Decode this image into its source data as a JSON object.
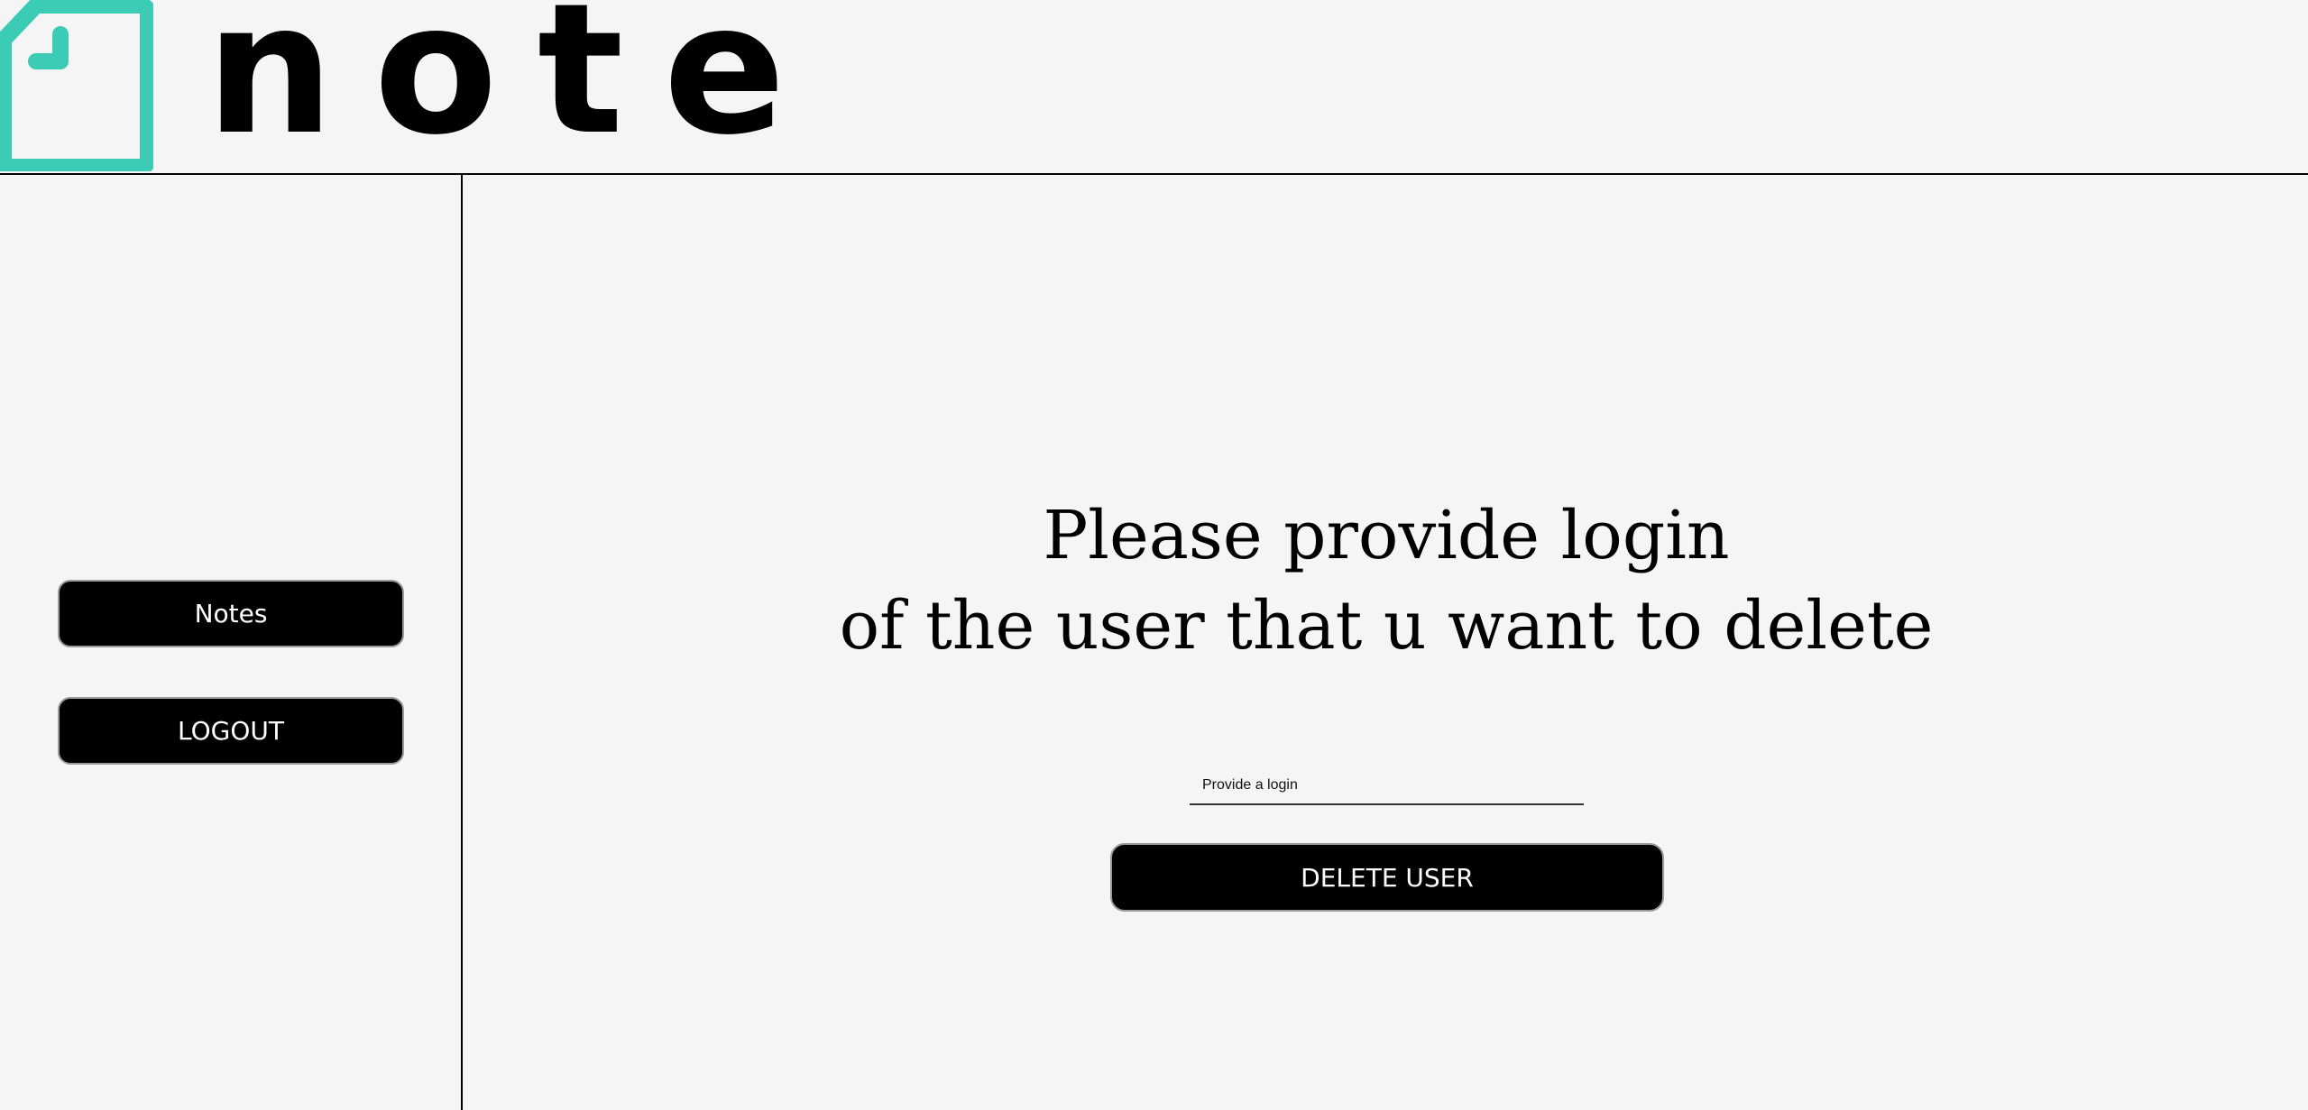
{
  "brand": {
    "name": "note",
    "accent_color": "#3ccbb4",
    "logo_icon": "note-page-icon"
  },
  "sidebar": {
    "items": [
      {
        "label": "Notes"
      },
      {
        "label": "LOGOUT"
      }
    ]
  },
  "main": {
    "prompt_line1": "Please provide login",
    "prompt_line2": "of the user that u want to delete",
    "login_placeholder": "Provide a login",
    "login_value": "",
    "delete_button_label": "DELETE USER"
  }
}
